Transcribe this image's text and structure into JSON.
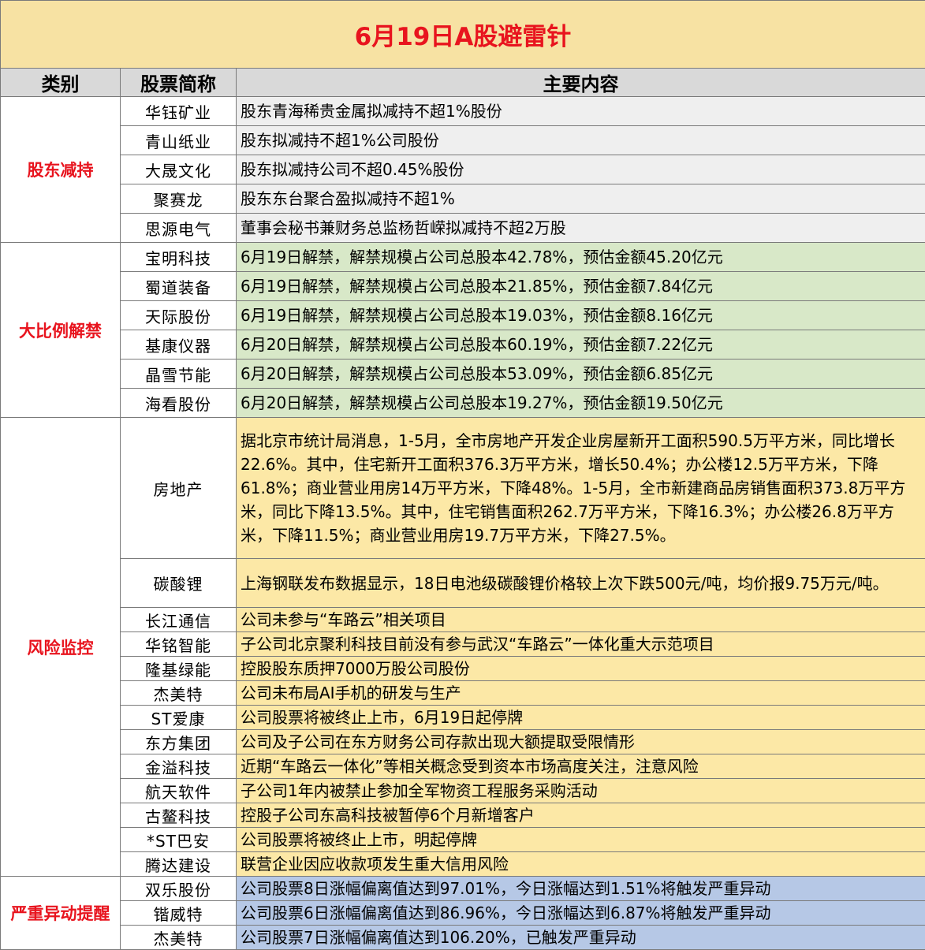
{
  "title": "6月19日A股避雷针",
  "headers": {
    "category": "类别",
    "stock": "股票简称",
    "content": "主要内容"
  },
  "sections": [
    {
      "category": "股东减持",
      "color": "#efefef",
      "rows": [
        {
          "stock": "华钰矿业",
          "content": "股东青海稀贵金属拟减持不超1%股份"
        },
        {
          "stock": "青山纸业",
          "content": "股东拟减持不超1%公司股份"
        },
        {
          "stock": "大晟文化",
          "content": "股东拟减持公司不超0.45%股份"
        },
        {
          "stock": "聚赛龙",
          "content": "股东东台聚合盈拟减持不超1%"
        },
        {
          "stock": "思源电气",
          "content": "董事会秘书兼财务总监杨哲嵘拟减持不超2万股"
        }
      ]
    },
    {
      "category": "大比例解禁",
      "color": "#d8e8c8",
      "rows": [
        {
          "stock": "宝明科技",
          "content": "6月19日解禁，解禁规模占公司总股本42.78%，预估金额45.20亿元"
        },
        {
          "stock": "蜀道装备",
          "content": "6月19日解禁，解禁规模占公司总股本21.85%，预估金额7.84亿元"
        },
        {
          "stock": "天际股份",
          "content": "6月19日解禁，解禁规模占公司总股本19.03%，预估金额8.16亿元"
        },
        {
          "stock": "基康仪器",
          "content": "6月20日解禁，解禁规模占公司总股本60.19%，预估金额7.22亿元"
        },
        {
          "stock": "晶雪节能",
          "content": "6月20日解禁，解禁规模占公司总股本53.09%，预估金额6.85亿元"
        },
        {
          "stock": "海看股份",
          "content": "6月20日解禁，解禁规模占公司总股本19.27%，预估金额19.50亿元"
        }
      ]
    },
    {
      "category": "风险监控",
      "color": "#fce8a6",
      "rows": [
        {
          "stock": "房地产",
          "content": "据北京市统计局消息，1-5月，全市房地产开发企业房屋新开工面积590.5万平方米，同比增长22.6%。其中，住宅新开工面积376.3万平方米，增长50.4%；办公楼12.5万平方米，下降61.8%；商业营业用房14万平方米，下降48%。1-5月，全市新建商品房销售面积373.8万平方米，同比下降13.5%。其中，住宅销售面积262.7万平方米，下降16.3%；办公楼26.8万平方米，下降11.5%；商业营业用房19.7万平方米，下降27.5%。"
        },
        {
          "stock": "碳酸锂",
          "content": "上海钢联发布数据显示，18日电池级碳酸锂价格较上次下跌500元/吨，均价报9.75万元/吨。"
        },
        {
          "stock": "长江通信",
          "content": "公司未参与“车路云”相关项目"
        },
        {
          "stock": "华铭智能",
          "content": "子公司北京聚利科技目前没有参与武汉“车路云”一体化重大示范项目"
        },
        {
          "stock": "隆基绿能",
          "content": "控股股东质押7000万股公司股份"
        },
        {
          "stock": "杰美特",
          "content": "公司未布局AI手机的研发与生产"
        },
        {
          "stock": "ST爱康",
          "content": "公司股票将被终止上市，6月19日起停牌"
        },
        {
          "stock": "东方集团",
          "content": "公司及子公司在东方财务公司存款出现大额提取受限情形"
        },
        {
          "stock": "金溢科技",
          "content": "近期“车路云一体化”等相关概念受到资本市场高度关注，注意风险"
        },
        {
          "stock": "航天软件",
          "content": "子公司1年内被禁止参加全军物资工程服务采购活动"
        },
        {
          "stock": "古鳌科技",
          "content": "控股子公司东高科技被暂停6个月新增客户"
        },
        {
          "stock": "*ST巴安",
          "content": "公司股票将被终止上市，明起停牌"
        },
        {
          "stock": "腾达建设",
          "content": "联营企业因应收款项发生重大信用风险"
        }
      ]
    },
    {
      "category": "严重异动提醒",
      "color": "#b6c8e6",
      "rows": [
        {
          "stock": "双乐股份",
          "content": "公司股票8日涨幅偏离值达到97.01%，今日涨幅达到1.51%将触发严重异动"
        },
        {
          "stock": "锴威特",
          "content": "公司股票6日涨幅偏离值达到86.96%，今日涨幅达到6.87%将触发严重异动"
        },
        {
          "stock": "杰美特",
          "content": "公司股票7日涨幅偏离值达到106.20%，已触发严重异动"
        }
      ]
    }
  ]
}
